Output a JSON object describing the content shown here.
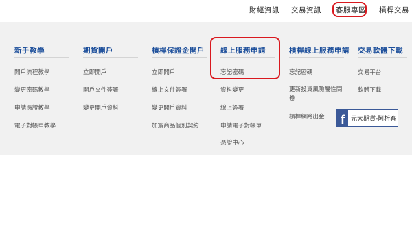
{
  "top_nav": {
    "items": [
      "財經資訊",
      "交易資訊",
      "客服專區",
      "槓桿交易"
    ],
    "active": "客服專區"
  },
  "columns": [
    {
      "heading": "新手教學",
      "items": [
        "開戶流程教學",
        "變更密碼教學",
        "申請憑證教學",
        "電子對帳單教學"
      ]
    },
    {
      "heading": "期貨開戶",
      "items": [
        "立即開戶",
        "開戶文件簽署",
        "變更開戶資料"
      ]
    },
    {
      "heading": "槓桿保證金開戶",
      "items": [
        "立即開戶",
        "線上文件簽署",
        "變更開戶資料",
        "加簽商品個別契約"
      ]
    },
    {
      "heading": "線上服務申請",
      "items": [
        "忘記密碼",
        "資料變更",
        "線上簽署",
        "申請電子對帳單",
        "憑證中心"
      ]
    },
    {
      "heading": "槓桿線上服務申請",
      "items": [
        "忘記密碼",
        "更新投資風險屬性問卷",
        "槓桿網路出金"
      ]
    },
    {
      "heading": "交易軟體下載",
      "items": [
        "交易平台",
        "軟體下載"
      ]
    }
  ],
  "facebook_badge": {
    "icon": "facebook-icon",
    "label": "元大期貨-阿析客"
  },
  "colors": {
    "heading": "#1d4f9b",
    "highlight": "#d9191f",
    "panel": "#f1f1f1",
    "facebook": "#3b5998"
  }
}
